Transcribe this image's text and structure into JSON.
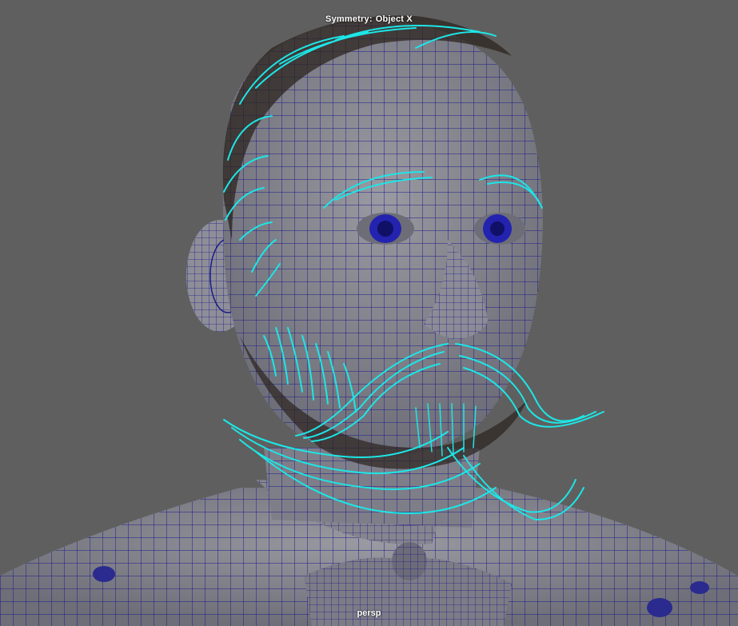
{
  "viewport": {
    "camera_label": "persp",
    "symmetry_label": "Symmetry:",
    "symmetry_value": "Object X",
    "background_color": "#5f5f5f",
    "mesh_color": "#15157a",
    "surface_color": "#8a8a93",
    "curve_color": "#1de6e6"
  }
}
